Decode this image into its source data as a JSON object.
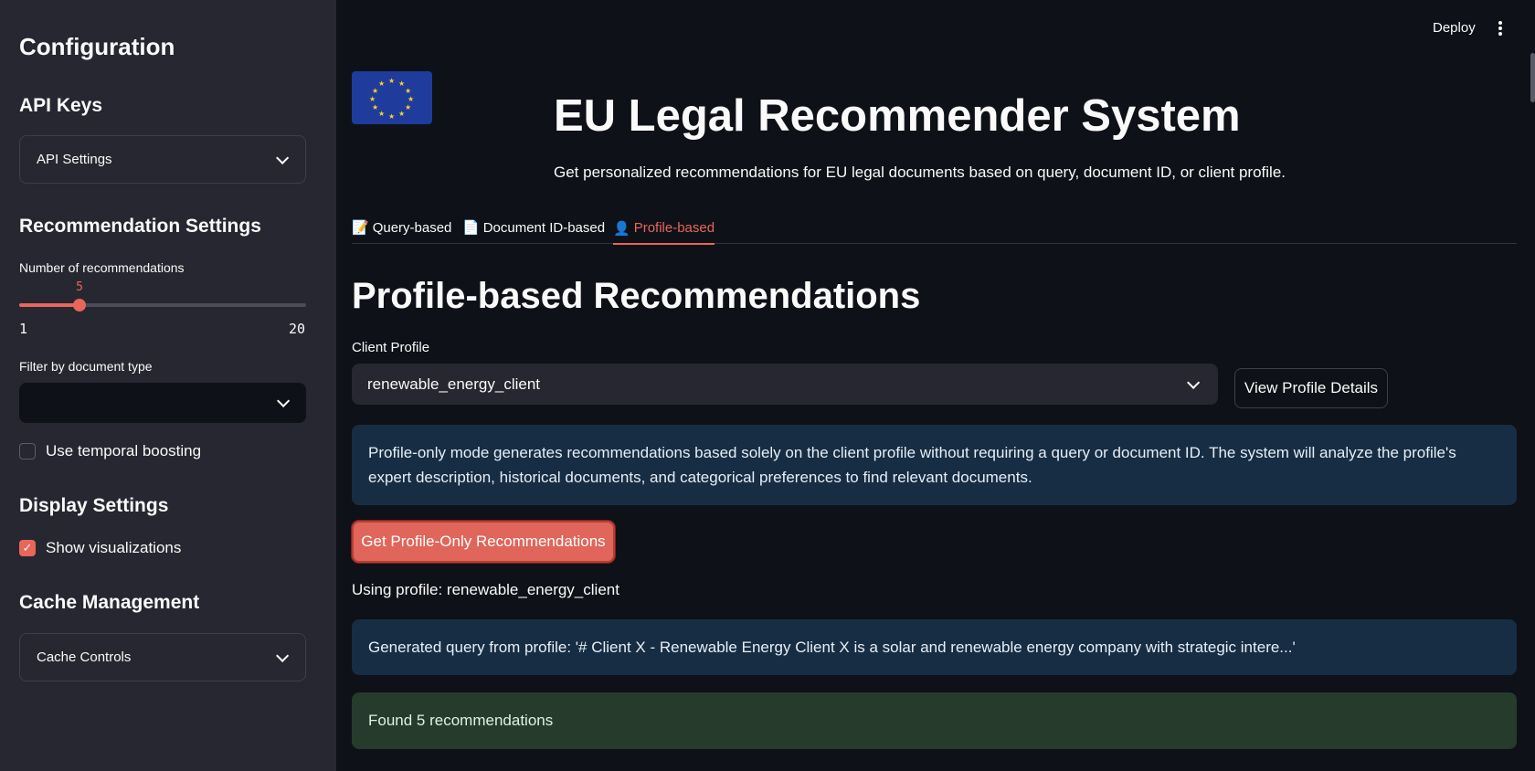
{
  "sidebar": {
    "title": "Configuration",
    "api_keys": {
      "heading": "API Keys",
      "expander_label": "API Settings"
    },
    "recommendation_settings": {
      "heading": "Recommendation Settings",
      "num_label": "Number of recommendations",
      "slider": {
        "value": "5",
        "min": "1",
        "max": "20"
      },
      "filter_label": "Filter by document type",
      "filter_value": "",
      "temporal_label": "Use temporal boosting",
      "temporal_checked": false
    },
    "display_settings": {
      "heading": "Display Settings",
      "visualizations_label": "Show visualizations",
      "visualizations_checked": true
    },
    "cache": {
      "heading": "Cache Management",
      "expander_label": "Cache Controls"
    }
  },
  "topbar": {
    "deploy_label": "Deploy"
  },
  "header": {
    "title": "EU Legal Recommender System",
    "subtitle": "Get personalized recommendations for EU legal documents based on query, document ID, or client profile."
  },
  "tabs": [
    {
      "icon": "📝",
      "label": "Query-based"
    },
    {
      "icon": "📄",
      "label": "Document ID-based"
    },
    {
      "icon": "👤",
      "label": "Profile-based",
      "active": true
    }
  ],
  "main": {
    "section_title": "Profile-based Recommendations",
    "client_profile_label": "Client Profile",
    "client_profile_value": "renewable_energy_client",
    "view_profile_button": "View Profile Details",
    "info_text": "Profile-only mode generates recommendations based solely on the client profile without requiring a query or document ID. The system will analyze the profile's expert description, historical documents, and categorical preferences to find relevant documents.",
    "get_button": "Get Profile-Only Recommendations",
    "using_profile": "Using profile: renewable_energy_client",
    "generated_query": "Generated query from profile: '# Client X - Renewable Energy Client X is a solar and renewable energy company with strategic intere...'",
    "found_text": "Found 5 recommendations"
  },
  "colors": {
    "accent": "#e8665a",
    "background": "#0e1117",
    "sidebar": "#262730",
    "info": "#172d43",
    "success": "#263b2c"
  }
}
